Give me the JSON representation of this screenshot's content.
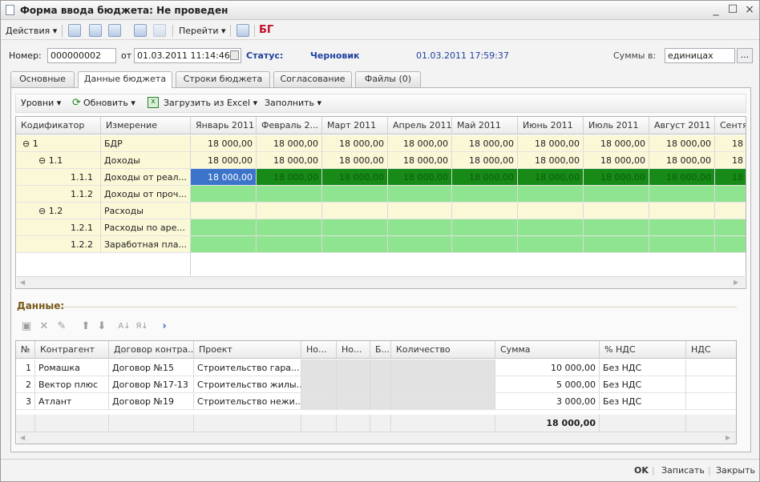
{
  "window": {
    "title": "Форма ввода бюджета: Не проведен",
    "min": "_",
    "max": "☐",
    "close": "×"
  },
  "toolbar": {
    "actions": "Действия ▾",
    "goto": "Перейти ▾",
    "brand": "БГ"
  },
  "header": {
    "number_label": "Номер:",
    "number": "000000002",
    "date_label": "от",
    "date": "01.03.2011 11:14:46",
    "status_label": "Статус:",
    "status": "Черновик",
    "timestamp": "01.03.2011 17:59:37",
    "sums_label": "Суммы в:",
    "sums_value": "единицах",
    "more": "..."
  },
  "tabs": [
    "Основные",
    "Данные бюджета",
    "Строки бюджета",
    "Согласование",
    "Файлы (0)"
  ],
  "panel_toolbar": {
    "levels": "Уровни ▾",
    "refresh": "Обновить ▾",
    "excel": "Загрузить из Excel ▾",
    "fill": "Заполнить ▾"
  },
  "budget_grid": {
    "columns": [
      "Кодификатор",
      "Измерение",
      "Январь 2011",
      "Февраль 2...",
      "Март 2011",
      "Апрель 2011",
      "Май 2011",
      "Июнь 2011",
      "Июль 2011",
      "Август 2011",
      "Сентя"
    ],
    "rows": [
      {
        "code": "⊖ 1",
        "dim": "БДР",
        "values": [
          "18 000,00",
          "18 000,00",
          "18 000,00",
          "18 000,00",
          "18 000,00",
          "18 000,00",
          "18 000,00",
          "18 000,00",
          "18"
        ]
      },
      {
        "code": "⊖ 1.1",
        "dim": "Доходы",
        "values": [
          "18 000,00",
          "18 000,00",
          "18 000,00",
          "18 000,00",
          "18 000,00",
          "18 000,00",
          "18 000,00",
          "18 000,00",
          "18"
        ]
      },
      {
        "code": "1.1.1",
        "dim": "Доходы от реал...",
        "values": [
          "18 000,00",
          "18 000,00",
          "18 000,00",
          "18 000,00",
          "18 000,00",
          "18 000,00",
          "18 000,00",
          "18 000,00",
          "18"
        ]
      },
      {
        "code": "1.1.2",
        "dim": "Доходы от проч...",
        "values": [
          "",
          "",
          "",
          "",
          "",
          "",
          "",
          "",
          ""
        ]
      },
      {
        "code": "⊖ 1.2",
        "dim": "Расходы",
        "values": [
          "",
          "",
          "",
          "",
          "",
          "",
          "",
          "",
          ""
        ]
      },
      {
        "code": "1.2.1",
        "dim": "Расходы по аре...",
        "values": [
          "",
          "",
          "",
          "",
          "",
          "",
          "",
          "",
          ""
        ]
      },
      {
        "code": "1.2.2",
        "dim": "Заработная пла...",
        "values": [
          "",
          "",
          "",
          "",
          "",
          "",
          "",
          "",
          ""
        ]
      }
    ]
  },
  "data_section": {
    "title": "Данные:"
  },
  "data_grid": {
    "columns": [
      "№",
      "Контрагент",
      "Договор контра...",
      "Проект",
      "Но...",
      "Но...",
      "Б...",
      "Количество",
      "Сумма",
      "% НДС",
      "НДС"
    ],
    "rows": [
      {
        "n": "1",
        "agent": "Ромашка",
        "contract": "Договор №15",
        "project": "Строительство гара...",
        "sum": "10 000,00",
        "vat": "Без НДС"
      },
      {
        "n": "2",
        "agent": "Вектор плюс",
        "contract": "Договор №17-13",
        "project": "Строительство жилы...",
        "sum": "5 000,00",
        "vat": "Без НДС"
      },
      {
        "n": "3",
        "agent": "Атлант",
        "contract": "Договор №19",
        "project": "Строительство нежи...",
        "sum": "3 000,00",
        "vat": "Без НДС"
      }
    ],
    "total": "18 000,00"
  },
  "footer": {
    "ok": "OK",
    "save": "Записать",
    "close": "Закрыть"
  }
}
